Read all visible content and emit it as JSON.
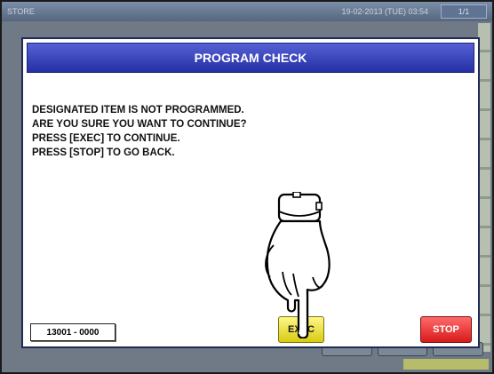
{
  "topbar": {
    "store_label": "STORE",
    "datetime": "19-02-2013 (TUE) 03:54",
    "page_indicator": "1/1"
  },
  "dialog": {
    "title": "PROGRAM CHECK",
    "message_lines": [
      "DESIGNATED ITEM IS NOT PROGRAMMED.",
      "ARE YOU SURE YOU WANT TO CONTINUE?",
      "PRESS [EXEC] TO CONTINUE.",
      "PRESS [STOP] TO GO BACK."
    ],
    "code": "13001 - 0000",
    "exec_label": "EXEC",
    "stop_label": "STOP"
  },
  "colors": {
    "header": "#2f3ab0",
    "exec": "#f2e93a",
    "stop": "#e52a2a"
  },
  "icons": {
    "pointer": "hand-pointer-icon"
  }
}
